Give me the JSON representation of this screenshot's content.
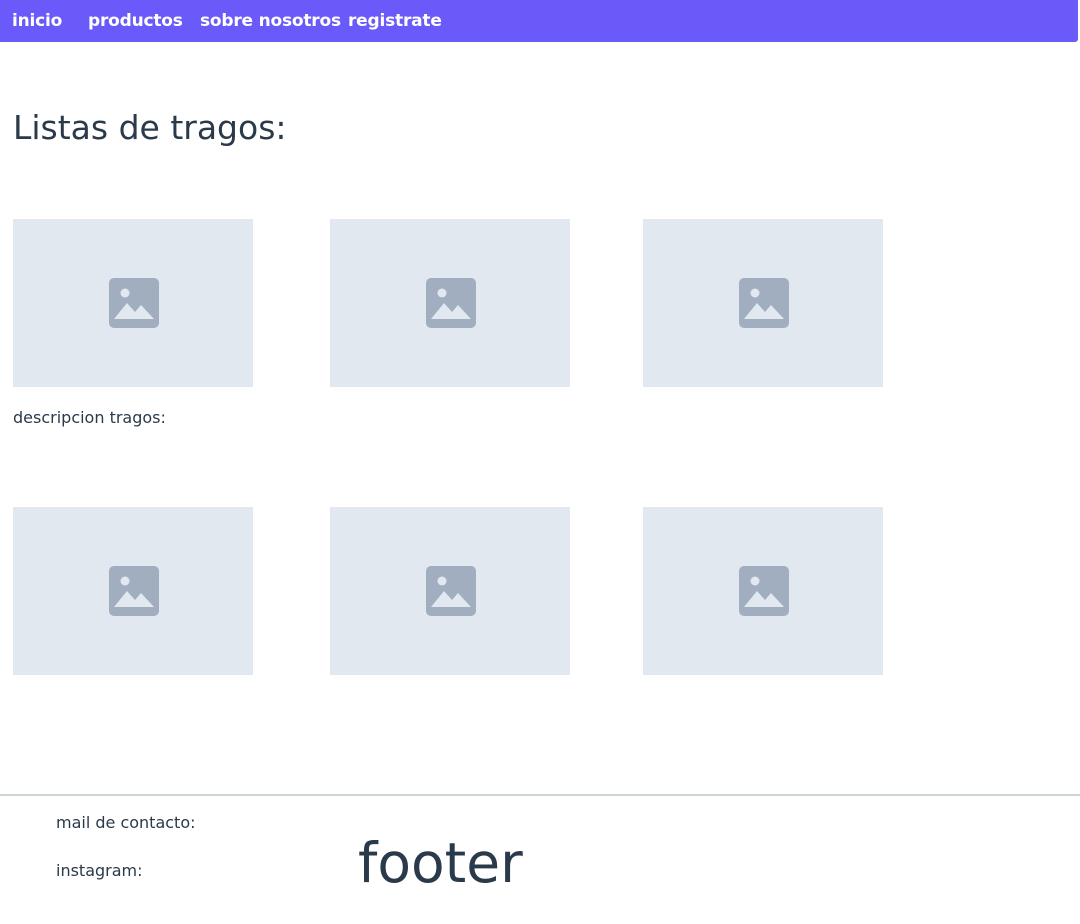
{
  "nav": {
    "items": [
      {
        "label": "inicio"
      },
      {
        "label": "productos"
      },
      {
        "label": "sobre nosotros"
      },
      {
        "label": "registrate"
      }
    ],
    "background": "#6a5af9"
  },
  "main": {
    "title": "Listas de tragos:",
    "images_row1": [
      {
        "icon": "image-placeholder-icon"
      },
      {
        "icon": "image-placeholder-icon"
      },
      {
        "icon": "image-placeholder-icon"
      }
    ],
    "description_label": "descripcion tragos:",
    "images_row2": [
      {
        "icon": "image-placeholder-icon"
      },
      {
        "icon": "image-placeholder-icon"
      },
      {
        "icon": "image-placeholder-icon"
      }
    ],
    "placeholder_bg": "#e2e8f0",
    "placeholder_icon_color": "#a0aec0"
  },
  "footer": {
    "mail_label": "mail de contacto:",
    "instagram_label": "instagram:",
    "title": "footer"
  }
}
